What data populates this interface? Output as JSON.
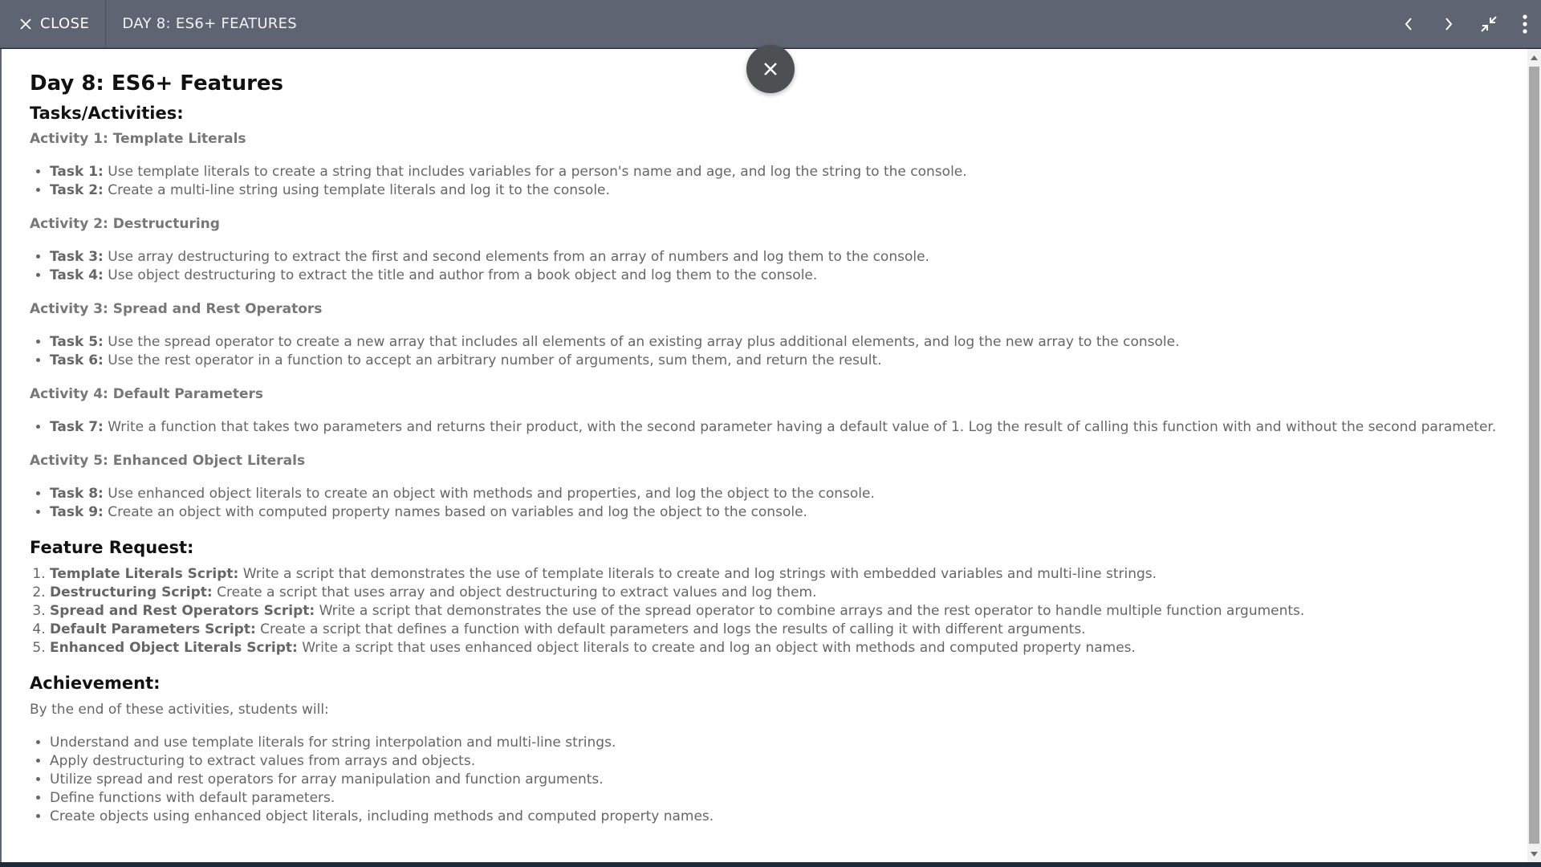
{
  "topbar": {
    "close_label": "CLOSE",
    "title": "DAY 8: ES6+ FEATURES",
    "icons": [
      "chevron-left-icon",
      "chevron-right-icon",
      "collapse-icon",
      "more-vertical-icon"
    ]
  },
  "doc": {
    "title": "Day 8: ES6+ Features",
    "tasks_heading": "Tasks/Activities:",
    "activities": [
      {
        "title": "Activity 1: Template Literals",
        "tasks": [
          {
            "label": "Task 1:",
            "text": " Use template literals to create a string that includes variables for a person's name and age, and log the string to the console."
          },
          {
            "label": "Task 2:",
            "text": " Create a multi-line string using template literals and log it to the console."
          }
        ]
      },
      {
        "title": "Activity 2: Destructuring",
        "tasks": [
          {
            "label": "Task 3:",
            "text": " Use array destructuring to extract the first and second elements from an array of numbers and log them to the console."
          },
          {
            "label": "Task 4:",
            "text": " Use object destructuring to extract the title and author from a book object and log them to the console."
          }
        ]
      },
      {
        "title": "Activity 3: Spread and Rest Operators",
        "tasks": [
          {
            "label": "Task 5:",
            "text": " Use the spread operator to create a new array that includes all elements of an existing array plus additional elements, and log the new array to the console."
          },
          {
            "label": "Task 6:",
            "text": " Use the rest operator in a function to accept an arbitrary number of arguments, sum them, and return the result."
          }
        ]
      },
      {
        "title": "Activity 4: Default Parameters",
        "tasks": [
          {
            "label": "Task 7:",
            "text": " Write a function that takes two parameters and returns their product, with the second parameter having a default value of 1. Log the result of calling this function with and without the second parameter."
          }
        ]
      },
      {
        "title": "Activity 5: Enhanced Object Literals",
        "tasks": [
          {
            "label": "Task 8:",
            "text": " Use enhanced object literals to create an object with methods and properties, and log the object to the console."
          },
          {
            "label": "Task 9:",
            "text": " Create an object with computed property names based on variables and log the object to the console."
          }
        ]
      }
    ],
    "feature_heading": "Feature Request:",
    "features": [
      {
        "label": "Template Literals Script:",
        "text": " Write a script that demonstrates the use of template literals to create and log strings with embedded variables and multi-line strings."
      },
      {
        "label": "Destructuring Script:",
        "text": " Create a script that uses array and object destructuring to extract values and log them."
      },
      {
        "label": "Spread and Rest Operators Script:",
        "text": " Write a script that demonstrates the use of the spread operator to combine arrays and the rest operator to handle multiple function arguments."
      },
      {
        "label": "Default Parameters Script:",
        "text": " Create a script that defines a function with default parameters and logs the results of calling it with different arguments."
      },
      {
        "label": "Enhanced Object Literals Script:",
        "text": " Write a script that uses enhanced object literals to create and log an object with methods and computed property names."
      }
    ],
    "achievement_heading": "Achievement:",
    "achievement_intro": "By the end of these activities, students will:",
    "achievements": [
      "Understand and use template literals for string interpolation and multi-line strings.",
      "Apply destructuring to extract values from arrays and objects.",
      "Utilize spread and rest operators for array manipulation and function arguments.",
      "Define functions with default parameters.",
      "Create objects using enhanced object literals, including methods and computed property names."
    ]
  },
  "colors": {
    "topbar": "#5f6473",
    "heading": "#111111",
    "body_text": "#666666",
    "fab": "#4d4f52"
  }
}
